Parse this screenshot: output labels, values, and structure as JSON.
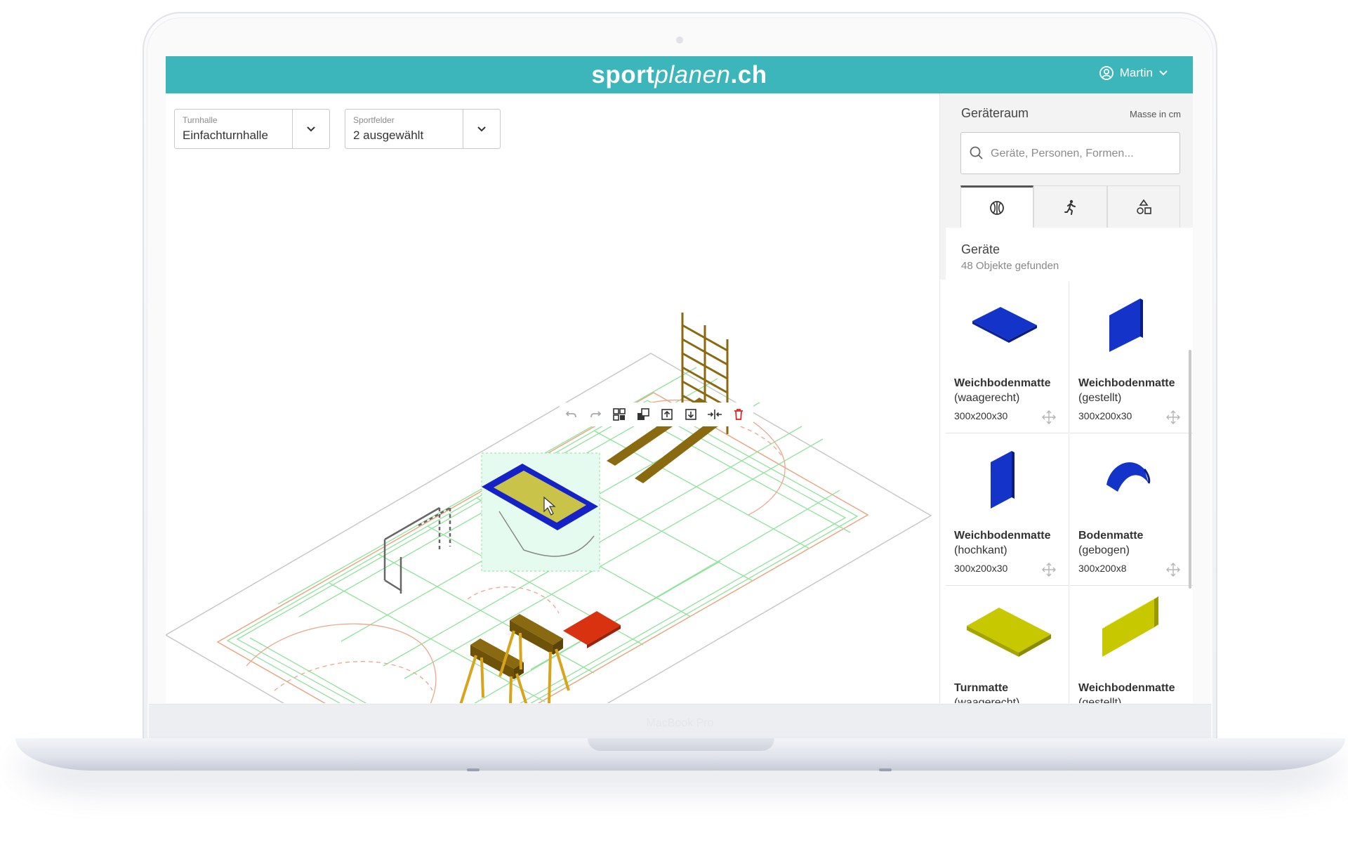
{
  "header": {
    "logo_sport": "sport",
    "logo_planen": "planen",
    "logo_tld": ".ch",
    "user_name": "Martin",
    "user_icon": "user-circle-icon"
  },
  "selectors": {
    "hall": {
      "label": "Turnhalle",
      "value": "Einfachturnhalle"
    },
    "fields": {
      "label": "Sportfelder",
      "value": "2 ausgewählt"
    }
  },
  "toolbar": {
    "tools": [
      "undo-icon",
      "redo-icon",
      "group-icon",
      "ungroup-icon",
      "bring-forward-icon",
      "send-backward-icon",
      "align-icon",
      "delete-icon"
    ]
  },
  "panel": {
    "title": "Geräteraum",
    "unit": "Masse in cm",
    "search_placeholder": "Geräte, Personen, Formen...",
    "tabs": [
      "ball-icon",
      "person-running-icon",
      "shapes-icon"
    ],
    "section_title": "Geräte",
    "section_count": "48 Objekte gefunden",
    "items": [
      {
        "name": "Weichbodenmatte",
        "variant": "(waagerecht)",
        "dims": "300x200x30"
      },
      {
        "name": "Weichbodenmatte",
        "variant": "(gestellt)",
        "dims": "300x200x30"
      },
      {
        "name": "Weichbodenmatte",
        "variant": "(hochkant)",
        "dims": "300x200x30"
      },
      {
        "name": "Bodenmatte",
        "variant": "(gebogen)",
        "dims": "300x200x8"
      },
      {
        "name": "Turnmatte",
        "variant": "(waagerecht)",
        "dims": ""
      },
      {
        "name": "Weichbodenmatte",
        "variant": "(gestellt)",
        "dims": ""
      }
    ]
  },
  "device": {
    "label": "MacBook Pro"
  },
  "colors": {
    "brand": "#3cb6ba",
    "mat_blue": "#1433c8",
    "mat_yellow": "#c8c800",
    "equipment_brown": "#8a6a10",
    "court_lines": "#7fe08a",
    "delete": "#e02424"
  }
}
